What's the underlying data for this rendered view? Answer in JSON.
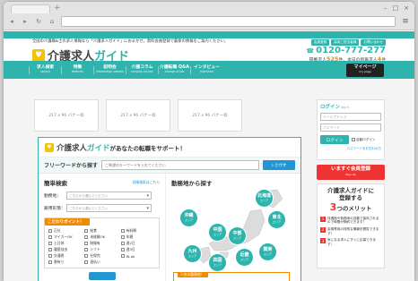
{
  "browser": {
    "new_tab": "+",
    "back": "◂",
    "forward": "▸",
    "reload": "↻",
    "home": "⌂",
    "menu": "≡"
  },
  "header": {
    "tagline": "全国の介護職&士の求人情報なら「介護求人ガイド」におまかせ。無料会員登録で最新の情報をご案内ください。",
    "logo_main": "介護求人",
    "logo_kana": "ガイド",
    "toplinks": [
      "会員登録",
      "採用ご担当者様",
      "お問い合わせ"
    ],
    "phone": "0120-777-277",
    "jobcount_prefix": "掲載求人",
    "jobcount_total": "525",
    "jobcount_mid": "件、本日の新着求人",
    "jobcount_new": "4",
    "jobcount_suffix": "件"
  },
  "nav": {
    "items": [
      {
        "ja": "求人検索",
        "en": "search"
      },
      {
        "ja": "特集",
        "en": "features"
      },
      {
        "ja": "説明会",
        "en": "information session"
      },
      {
        "ja": "介護コラム",
        "en": "nursing column"
      },
      {
        "ja": "介護転職 Q&A",
        "en": "change of job"
      },
      {
        "ja": "インタビュー",
        "en": "interview"
      }
    ],
    "mypage_ja": "マイページ",
    "mypage_en": "my page"
  },
  "banners": [
    "217 x 90 バナー枠",
    "217 x 90 バナー枠",
    "217 x 90 バナー枠"
  ],
  "search": {
    "logo_main": "介護求人",
    "logo_kana": "ガイド",
    "headline_rest": "があなたの転職をサポート！",
    "freeword_label": "フリーワードから探す",
    "freeword_placeholder": "ご希望のキーワードを入れてください",
    "freeword_button": "さがす",
    "simple_title": "簡単検索",
    "detail_link": "詳細検索はこちら",
    "fields": [
      {
        "label": "勤務地：",
        "placeholder": "こちらから選んでください"
      },
      {
        "label": "雇用形態：",
        "placeholder": "こちらから選んでください"
      }
    ],
    "kodawari_title": "こだわりポイント！",
    "kodawari": [
      "正社",
      "給食",
      "有料朝",
      "マイカーOK",
      "未経験OK",
      "年間",
      "土日休",
      "制服有",
      "週2日",
      "履歴自由",
      "シフト",
      "週3日",
      "交通費",
      "社保完",
      "W-ok",
      "寮有り",
      "週払い",
      ""
    ],
    "region_title": "勤務地から探す",
    "regions": [
      {
        "line1": "北海道",
        "line2": "エリア"
      },
      {
        "line1": "東北",
        "line2": "エリア"
      },
      {
        "line1": "沖縄",
        "line2": "エリア"
      },
      {
        "line1": "中部",
        "line2": "エリア"
      },
      {
        "line1": "中国",
        "line2": "エリア"
      },
      {
        "line1": "関東",
        "line2": "エリア"
      },
      {
        "line1": "九州",
        "line2": "エリア"
      },
      {
        "line1": "四国",
        "line2": "エリア"
      },
      {
        "line1": "近畿",
        "line2": "エリア"
      }
    ],
    "ninki_title": "人気の勤務地！"
  },
  "login": {
    "title": "ログイン",
    "title_en": "log in",
    "email_placeholder": "メールアドレス",
    "password_placeholder": "パスワード",
    "button": "ログイン",
    "auto_login": "自動ログイン",
    "forgot": "パスワードをお忘れの方"
  },
  "signup": {
    "ja": "いますぐ会員登録",
    "en": "Sign Up"
  },
  "merit": {
    "h1": "介護求人ガイドに",
    "h2": "登録する",
    "big": "3",
    "h3": "つのメリット",
    "items": [
      {
        "n": "1",
        "text": "待遇面や勤務地の自動で保存されるので時間が節約できます！"
      },
      {
        "n": "2",
        "text": "会員専用の特別な情報を閲覧できます！"
      },
      {
        "n": "3",
        "text": "気になる求人にすぐに応募できます！"
      }
    ]
  },
  "colors": {
    "teal": "#2fb3ad",
    "blue": "#2196d3",
    "orange": "#f08a00",
    "red": "#e33333",
    "yellow": "#f5c200"
  }
}
